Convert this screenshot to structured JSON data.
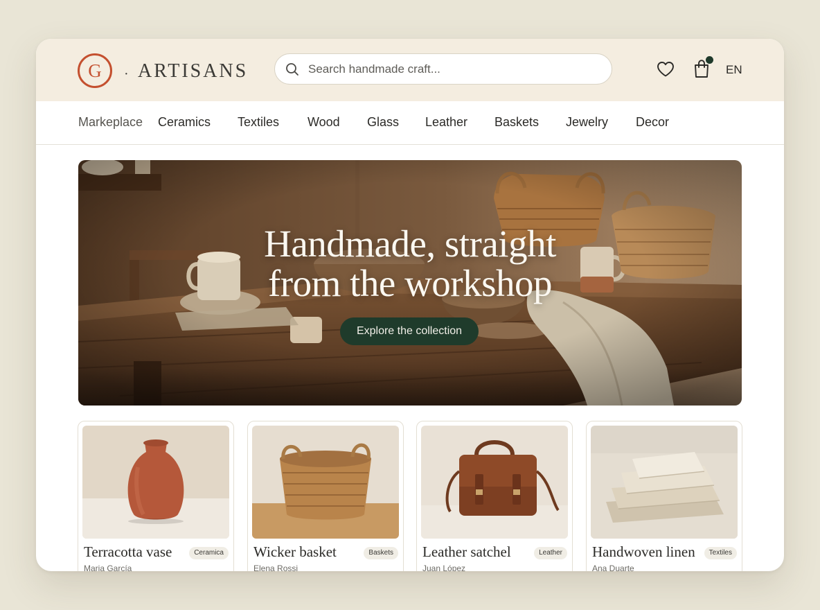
{
  "brand": {
    "mark": "G",
    "separator": "·",
    "name": "ARTISANS",
    "accent_color": "#c4502f"
  },
  "search": {
    "placeholder": "Search handmade craft...",
    "icon": "search-icon"
  },
  "header": {
    "wishlist_icon": "heart-icon",
    "cart_icon": "shopping-bag-icon",
    "cart_has_items": true,
    "language": "EN"
  },
  "nav": {
    "items": [
      "Markeplace",
      "Ceramics",
      "Textiles",
      "Wood",
      "Glass",
      "Leather",
      "Baskets",
      "Jewelry",
      "Decor"
    ]
  },
  "hero": {
    "title_line1": "Handmade, straight",
    "title_line2": "from the workshop",
    "cta": "Explore the collection",
    "cta_color": "#1f3b2b"
  },
  "products": [
    {
      "name": "Terracotta vase",
      "category": "Ceramica",
      "maker": "Maria García"
    },
    {
      "name": "Wicker basket",
      "category": "Baskets",
      "maker": "Elena Rossi"
    },
    {
      "name": "Leather satchel",
      "category": "Leather",
      "maker": "Juan López"
    },
    {
      "name": "Handwoven linen",
      "category": "Textiles",
      "maker": "Ana Duarte"
    }
  ]
}
